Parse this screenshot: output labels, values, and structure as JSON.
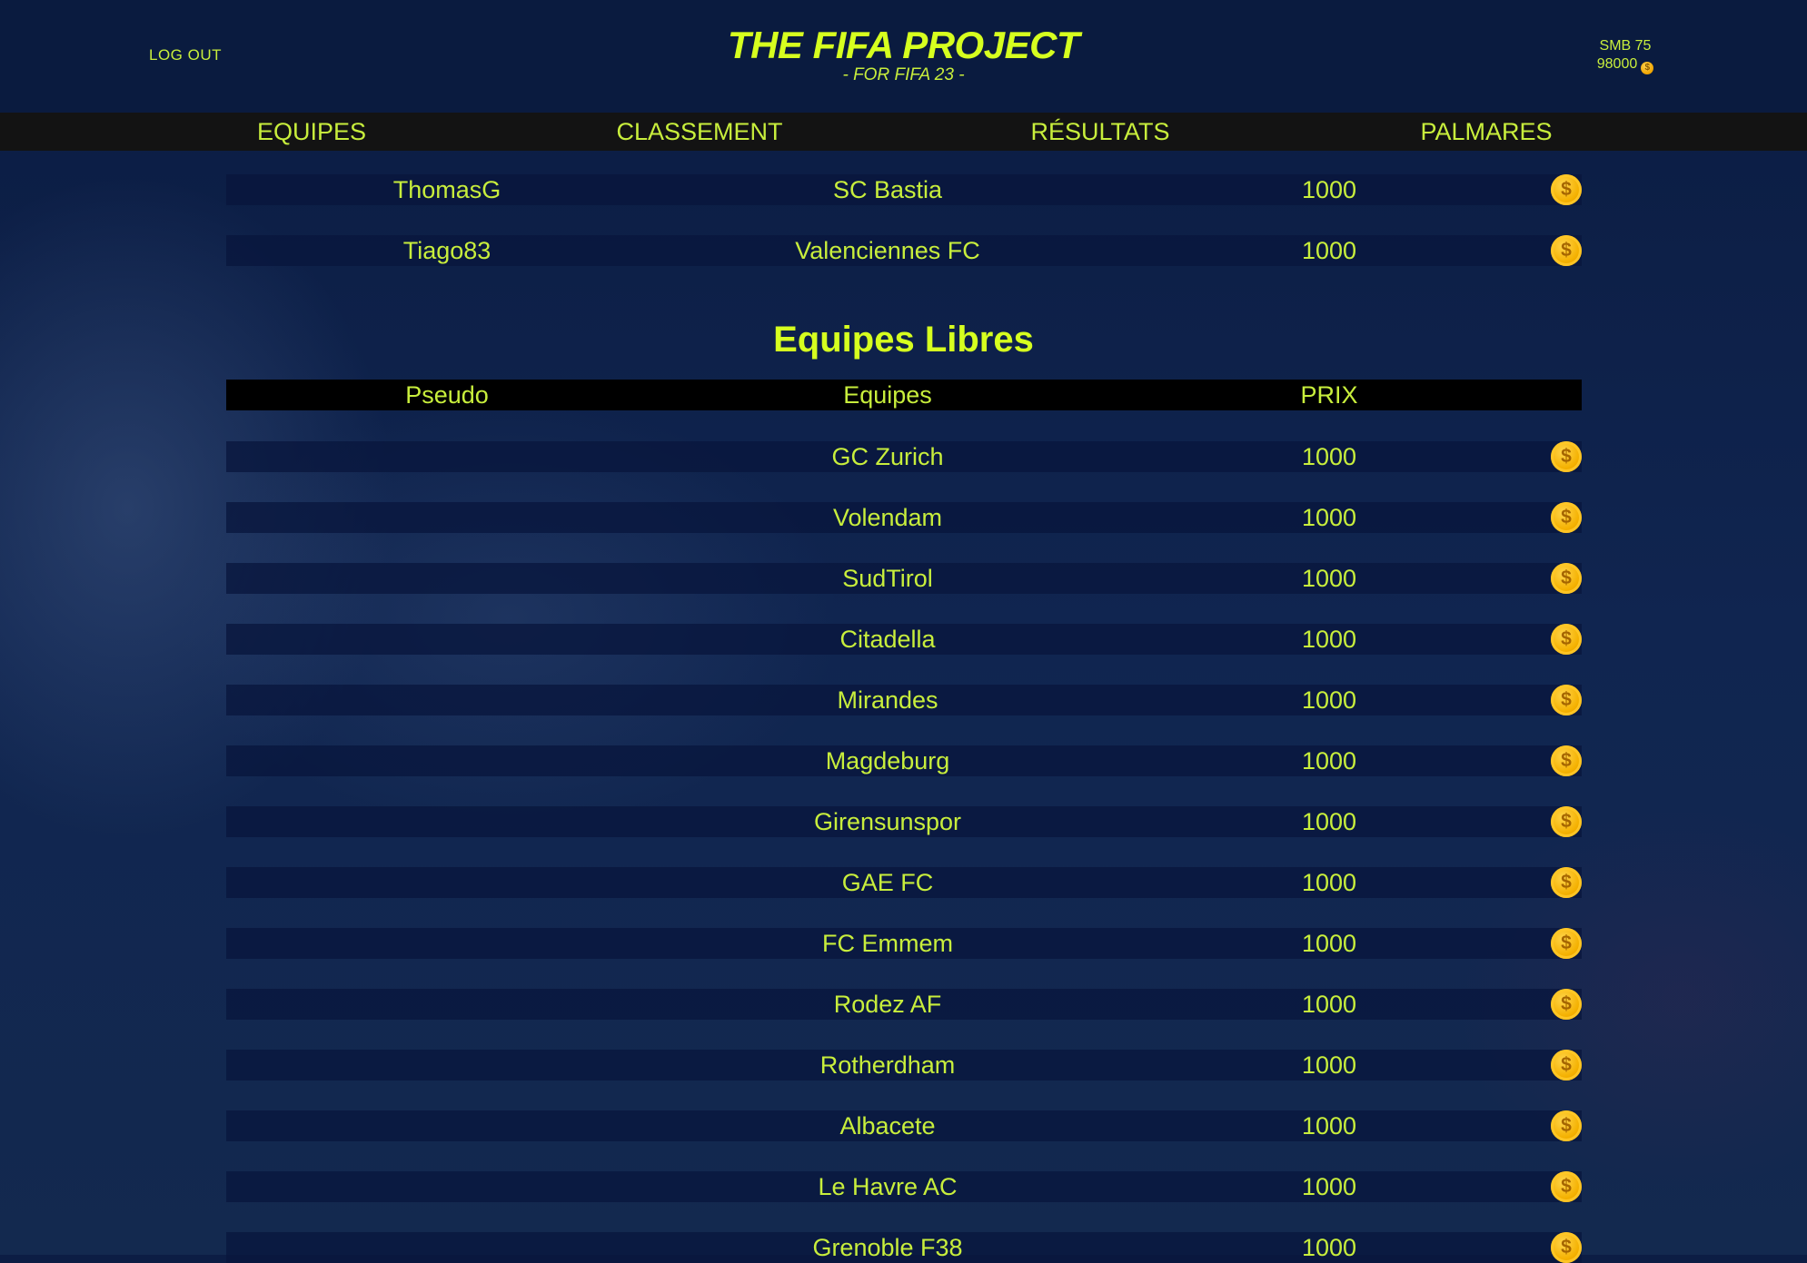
{
  "header": {
    "logout_label": "LOG OUT",
    "title": "THE FIFA PROJECT",
    "subtitle": "- FOR FIFA 23 -",
    "user_name": "SMB 75",
    "user_balance": "98000"
  },
  "nav": {
    "items": [
      "EQUIPES",
      "CLASSEMENT",
      "RÉSULTATS",
      "PALMARES"
    ]
  },
  "owned_rows": [
    {
      "pseudo": "ThomasG",
      "team": "SC Bastia",
      "price": "1000"
    },
    {
      "pseudo": "Tiago83",
      "team": "Valenciennes FC",
      "price": "1000"
    }
  ],
  "free_section": {
    "title": "Equipes Libres",
    "headers": {
      "pseudo": "Pseudo",
      "team": "Equipes",
      "price": "PRIX"
    },
    "rows": [
      {
        "pseudo": "",
        "team": "GC Zurich",
        "price": "1000"
      },
      {
        "pseudo": "",
        "team": "Volendam",
        "price": "1000"
      },
      {
        "pseudo": "",
        "team": "SudTirol",
        "price": "1000"
      },
      {
        "pseudo": "",
        "team": "Citadella",
        "price": "1000"
      },
      {
        "pseudo": "",
        "team": "Mirandes",
        "price": "1000"
      },
      {
        "pseudo": "",
        "team": "Magdeburg",
        "price": "1000"
      },
      {
        "pseudo": "",
        "team": "Girensunspor",
        "price": "1000"
      },
      {
        "pseudo": "",
        "team": "GAE FC",
        "price": "1000"
      },
      {
        "pseudo": "",
        "team": "FC Emmem",
        "price": "1000"
      },
      {
        "pseudo": "",
        "team": "Rodez AF",
        "price": "1000"
      },
      {
        "pseudo": "",
        "team": "Rotherdham",
        "price": "1000"
      },
      {
        "pseudo": "",
        "team": "Albacete",
        "price": "1000"
      },
      {
        "pseudo": "",
        "team": "Le Havre AC",
        "price": "1000"
      },
      {
        "pseudo": "",
        "team": "Grenoble F38",
        "price": "1000"
      }
    ]
  },
  "icons": {
    "coin": "dollar-coin-icon",
    "coin_glyph": "$"
  },
  "colors": {
    "accent": "#d6ff1f",
    "text": "#c8ee3c",
    "background": "#0c1d44",
    "coin": "#f4b000"
  }
}
